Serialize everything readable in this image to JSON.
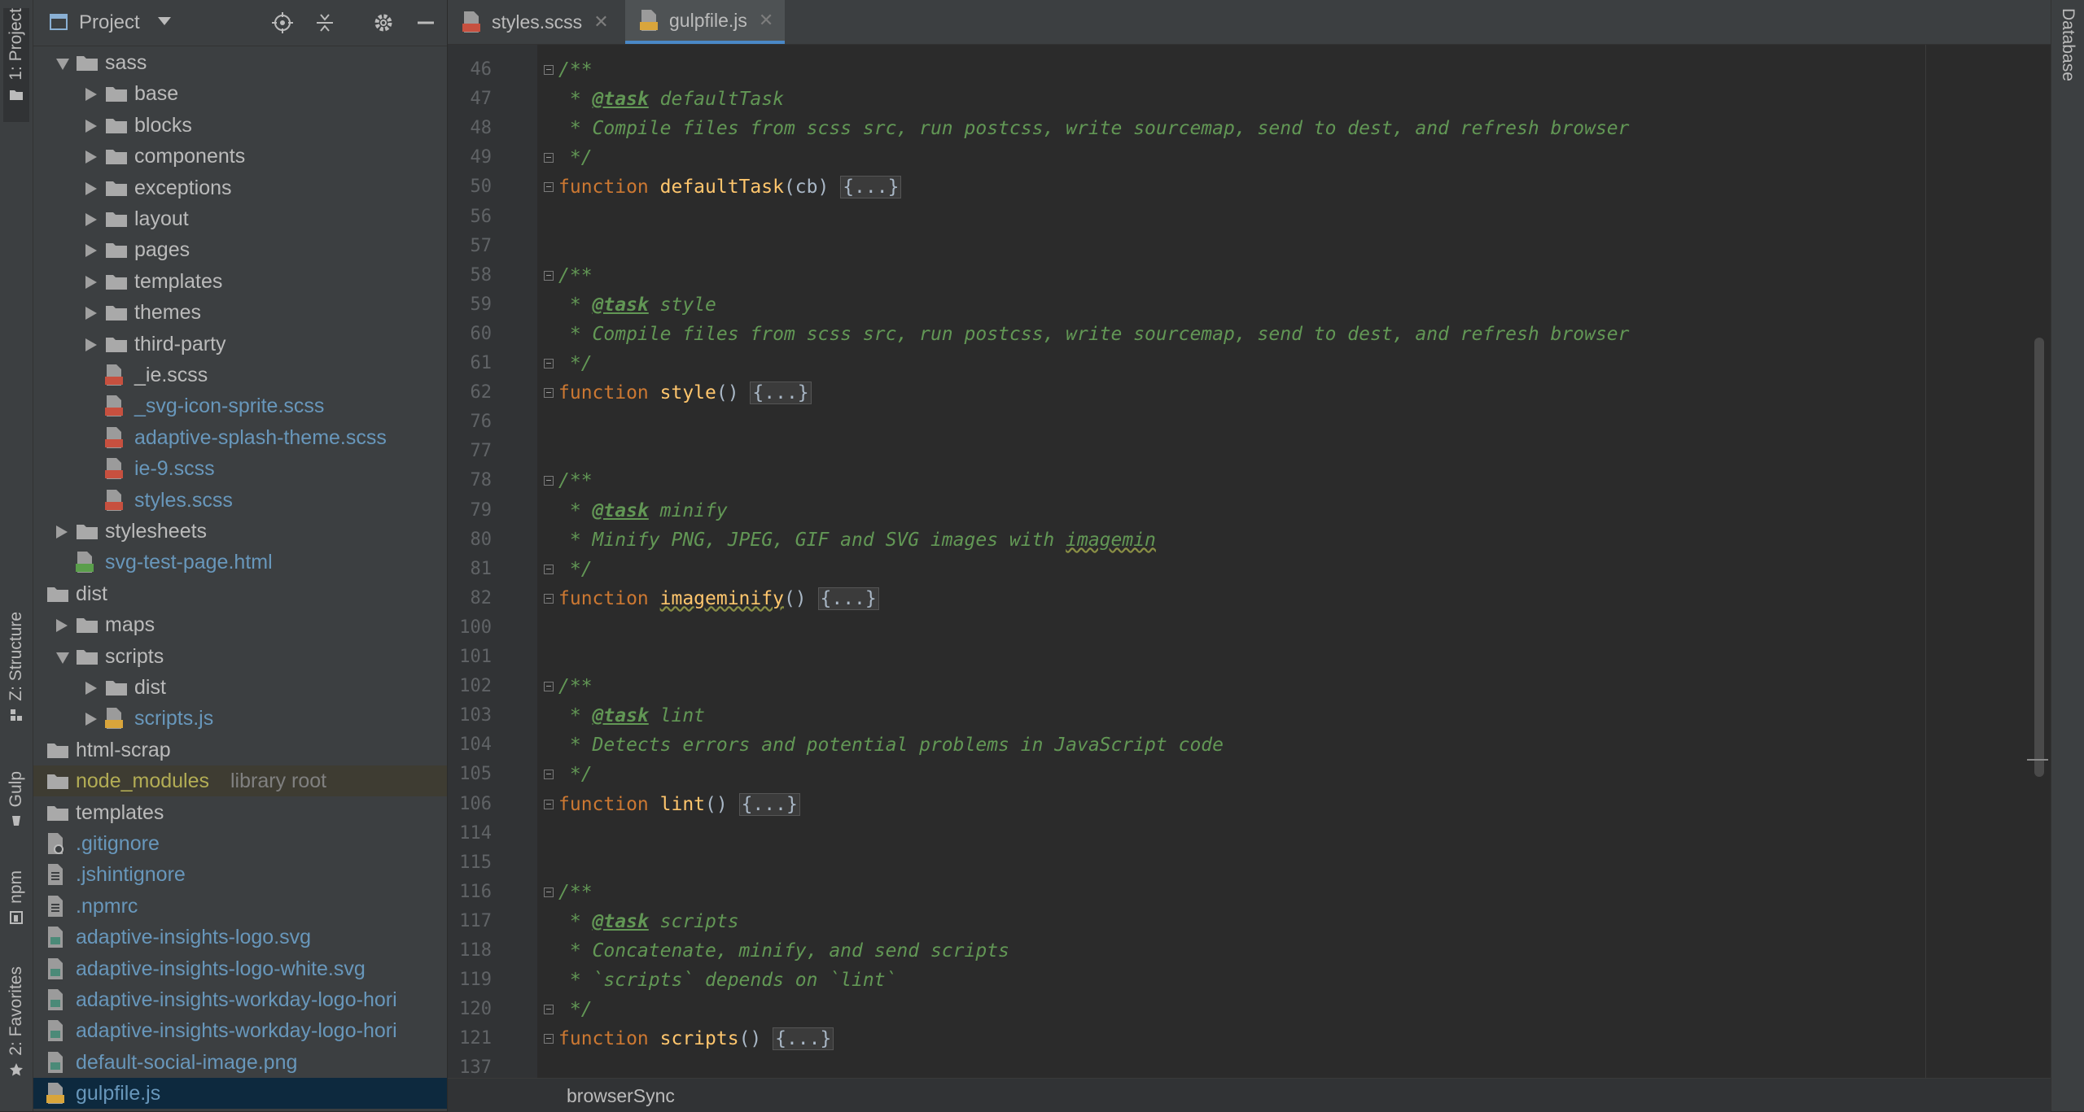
{
  "left_strip": {
    "tabs": [
      {
        "label": "1: Project",
        "icon": "folder-icon"
      },
      {
        "label": "Z: Structure",
        "icon": "structure-icon"
      },
      {
        "label": "Gulp",
        "icon": "gulp-icon"
      },
      {
        "label": "npm",
        "icon": "npm-icon"
      },
      {
        "label": "2: Favorites",
        "icon": "star-icon"
      }
    ]
  },
  "right_strip": {
    "label": "Database"
  },
  "project_panel": {
    "title": "Project",
    "tools": [
      "locate-icon",
      "collapse-all-icon",
      "gear-icon",
      "minimize-icon"
    ],
    "tree": [
      {
        "label": "sass",
        "type": "folder",
        "depth": 1,
        "arrow": "down",
        "color": "default"
      },
      {
        "label": "base",
        "type": "folder",
        "depth": 2,
        "arrow": "right",
        "color": "default"
      },
      {
        "label": "blocks",
        "type": "folder",
        "depth": 2,
        "arrow": "right",
        "color": "default"
      },
      {
        "label": "components",
        "type": "folder",
        "depth": 2,
        "arrow": "right",
        "color": "default"
      },
      {
        "label": "exceptions",
        "type": "folder",
        "depth": 2,
        "arrow": "right",
        "color": "default"
      },
      {
        "label": "layout",
        "type": "folder",
        "depth": 2,
        "arrow": "right",
        "color": "default"
      },
      {
        "label": "pages",
        "type": "folder",
        "depth": 2,
        "arrow": "right",
        "color": "default"
      },
      {
        "label": "templates",
        "type": "folder",
        "depth": 2,
        "arrow": "right",
        "color": "default"
      },
      {
        "label": "themes",
        "type": "folder",
        "depth": 2,
        "arrow": "right",
        "color": "default"
      },
      {
        "label": "third-party",
        "type": "folder",
        "depth": 2,
        "arrow": "right",
        "color": "default"
      },
      {
        "label": "_ie.scss",
        "type": "sass",
        "depth": 2,
        "arrow": "",
        "color": "default"
      },
      {
        "label": "_svg-icon-sprite.scss",
        "type": "sass",
        "depth": 2,
        "arrow": "",
        "color": "blue"
      },
      {
        "label": "adaptive-splash-theme.scss",
        "type": "sass",
        "depth": 2,
        "arrow": "",
        "color": "blue"
      },
      {
        "label": "ie-9.scss",
        "type": "sass",
        "depth": 2,
        "arrow": "",
        "color": "blue"
      },
      {
        "label": "styles.scss",
        "type": "sass",
        "depth": 2,
        "arrow": "",
        "color": "blue"
      },
      {
        "label": "stylesheets",
        "type": "folder",
        "depth": 1,
        "arrow": "right",
        "color": "default"
      },
      {
        "label": "svg-test-page.html",
        "type": "html",
        "depth": 1,
        "arrow": "",
        "color": "blue"
      },
      {
        "label": "dist",
        "type": "folder",
        "depth": 0,
        "arrow": "",
        "color": "default"
      },
      {
        "label": "maps",
        "type": "folder",
        "depth": 1,
        "arrow": "right",
        "color": "default"
      },
      {
        "label": "scripts",
        "type": "folder",
        "depth": 1,
        "arrow": "down",
        "color": "default"
      },
      {
        "label": "dist",
        "type": "folder",
        "depth": 2,
        "arrow": "right",
        "color": "default"
      },
      {
        "label": "scripts.js",
        "type": "js",
        "depth": 2,
        "arrow": "right",
        "color": "blue"
      },
      {
        "label": "html-scrap",
        "type": "folder",
        "depth": 0,
        "arrow": "",
        "color": "default"
      },
      {
        "label": "node_modules",
        "suffix": "library root",
        "type": "folder",
        "depth": 0,
        "arrow": "",
        "color": "olive",
        "state": "excluded"
      },
      {
        "label": "templates",
        "type": "folder",
        "depth": 0,
        "arrow": "",
        "color": "default"
      },
      {
        "label": ".gitignore",
        "type": "ignore",
        "depth": 0,
        "arrow": "",
        "color": "blue"
      },
      {
        "label": ".jshintignore",
        "type": "text",
        "depth": 0,
        "arrow": "",
        "color": "blue"
      },
      {
        "label": ".npmrc",
        "type": "text",
        "depth": 0,
        "arrow": "",
        "color": "blue"
      },
      {
        "label": "adaptive-insights-logo.svg",
        "type": "image",
        "depth": 0,
        "arrow": "",
        "color": "blue"
      },
      {
        "label": "adaptive-insights-logo-white.svg",
        "type": "image",
        "depth": 0,
        "arrow": "",
        "color": "blue"
      },
      {
        "label": "adaptive-insights-workday-logo-hori",
        "type": "image",
        "depth": 0,
        "arrow": "",
        "color": "blue"
      },
      {
        "label": "adaptive-insights-workday-logo-hori",
        "type": "image",
        "depth": 0,
        "arrow": "",
        "color": "blue"
      },
      {
        "label": "default-social-image.png",
        "type": "image",
        "depth": 0,
        "arrow": "",
        "color": "blue"
      },
      {
        "label": "gulpfile.js",
        "type": "js",
        "depth": 0,
        "arrow": "",
        "color": "blue",
        "state": "selected"
      }
    ]
  },
  "editor": {
    "tabs": [
      {
        "label": "styles.scss",
        "type": "sass",
        "active": false
      },
      {
        "label": "gulpfile.js",
        "type": "js",
        "active": true
      }
    ],
    "lines": [
      {
        "num": "46",
        "fold": true,
        "parts": [
          [
            "cm",
            "/**"
          ]
        ]
      },
      {
        "num": "47",
        "fold": false,
        "parts": [
          [
            "cm",
            " * "
          ],
          [
            "tag",
            "@task"
          ],
          [
            "cm",
            " defaultTask"
          ]
        ]
      },
      {
        "num": "48",
        "fold": false,
        "parts": [
          [
            "cm",
            " * Compile files from scss src, run postcss, write sourcemap, send to dest, and refresh browser"
          ]
        ]
      },
      {
        "num": "49",
        "fold": true,
        "parts": [
          [
            "cm",
            " */"
          ]
        ]
      },
      {
        "num": "50",
        "fold": true,
        "parts": [
          [
            "kw",
            "function "
          ],
          [
            "fn",
            "defaultTask"
          ],
          [
            "pl",
            "(cb) "
          ],
          [
            "fold",
            "{...}"
          ]
        ]
      },
      {
        "num": "56",
        "fold": false,
        "parts": []
      },
      {
        "num": "57",
        "fold": false,
        "parts": []
      },
      {
        "num": "58",
        "fold": true,
        "parts": [
          [
            "cm",
            "/**"
          ]
        ]
      },
      {
        "num": "59",
        "fold": false,
        "parts": [
          [
            "cm",
            " * "
          ],
          [
            "tag",
            "@task"
          ],
          [
            "cm",
            " style"
          ]
        ]
      },
      {
        "num": "60",
        "fold": false,
        "parts": [
          [
            "cm",
            " * Compile files from scss src, run postcss, write sourcemap, send to dest, and refresh browser"
          ]
        ]
      },
      {
        "num": "61",
        "fold": true,
        "parts": [
          [
            "cm",
            " */"
          ]
        ]
      },
      {
        "num": "62",
        "fold": true,
        "parts": [
          [
            "kw",
            "function "
          ],
          [
            "fn",
            "style"
          ],
          [
            "pl",
            "() "
          ],
          [
            "fold",
            "{...}"
          ]
        ]
      },
      {
        "num": "76",
        "fold": false,
        "parts": []
      },
      {
        "num": "77",
        "fold": false,
        "parts": []
      },
      {
        "num": "78",
        "fold": true,
        "parts": [
          [
            "cm",
            "/**"
          ]
        ]
      },
      {
        "num": "79",
        "fold": false,
        "parts": [
          [
            "cm",
            " * "
          ],
          [
            "tag",
            "@task"
          ],
          [
            "cm",
            " minify"
          ]
        ]
      },
      {
        "num": "80",
        "fold": false,
        "parts": [
          [
            "cm",
            " * Minify PNG, JPEG, GIF and SVG images with "
          ],
          [
            "cm squig",
            "imagemin"
          ]
        ]
      },
      {
        "num": "81",
        "fold": true,
        "parts": [
          [
            "cm",
            " */"
          ]
        ]
      },
      {
        "num": "82",
        "fold": true,
        "parts": [
          [
            "kw",
            "function "
          ],
          [
            "fn squig",
            "imageminify"
          ],
          [
            "pl",
            "() "
          ],
          [
            "fold",
            "{...}"
          ]
        ]
      },
      {
        "num": "100",
        "fold": false,
        "parts": []
      },
      {
        "num": "101",
        "fold": false,
        "parts": []
      },
      {
        "num": "102",
        "fold": true,
        "parts": [
          [
            "cm",
            "/**"
          ]
        ]
      },
      {
        "num": "103",
        "fold": false,
        "parts": [
          [
            "cm",
            " * "
          ],
          [
            "tag",
            "@task"
          ],
          [
            "cm",
            " lint"
          ]
        ]
      },
      {
        "num": "104",
        "fold": false,
        "parts": [
          [
            "cm",
            " * Detects errors and potential problems in JavaScript code"
          ]
        ]
      },
      {
        "num": "105",
        "fold": true,
        "parts": [
          [
            "cm",
            " */"
          ]
        ]
      },
      {
        "num": "106",
        "fold": true,
        "parts": [
          [
            "kw",
            "function "
          ],
          [
            "fn",
            "lint"
          ],
          [
            "pl",
            "() "
          ],
          [
            "fold",
            "{...}"
          ]
        ]
      },
      {
        "num": "114",
        "fold": false,
        "parts": []
      },
      {
        "num": "115",
        "fold": false,
        "parts": []
      },
      {
        "num": "116",
        "fold": true,
        "parts": [
          [
            "cm",
            "/**"
          ]
        ]
      },
      {
        "num": "117",
        "fold": false,
        "parts": [
          [
            "cm",
            " * "
          ],
          [
            "tag",
            "@task"
          ],
          [
            "cm",
            " scripts"
          ]
        ]
      },
      {
        "num": "118",
        "fold": false,
        "parts": [
          [
            "cm",
            " * Concatenate, minify, and send scripts"
          ]
        ]
      },
      {
        "num": "119",
        "fold": false,
        "parts": [
          [
            "cm",
            " * `scripts` depends on `lint`"
          ]
        ]
      },
      {
        "num": "120",
        "fold": true,
        "parts": [
          [
            "cm",
            " */"
          ]
        ]
      },
      {
        "num": "121",
        "fold": true,
        "parts": [
          [
            "kw",
            "function "
          ],
          [
            "fn",
            "scripts"
          ],
          [
            "pl",
            "() "
          ],
          [
            "fold",
            "{...}"
          ]
        ]
      },
      {
        "num": "137",
        "fold": false,
        "parts": []
      }
    ],
    "breadcrumb": "browserSync"
  }
}
